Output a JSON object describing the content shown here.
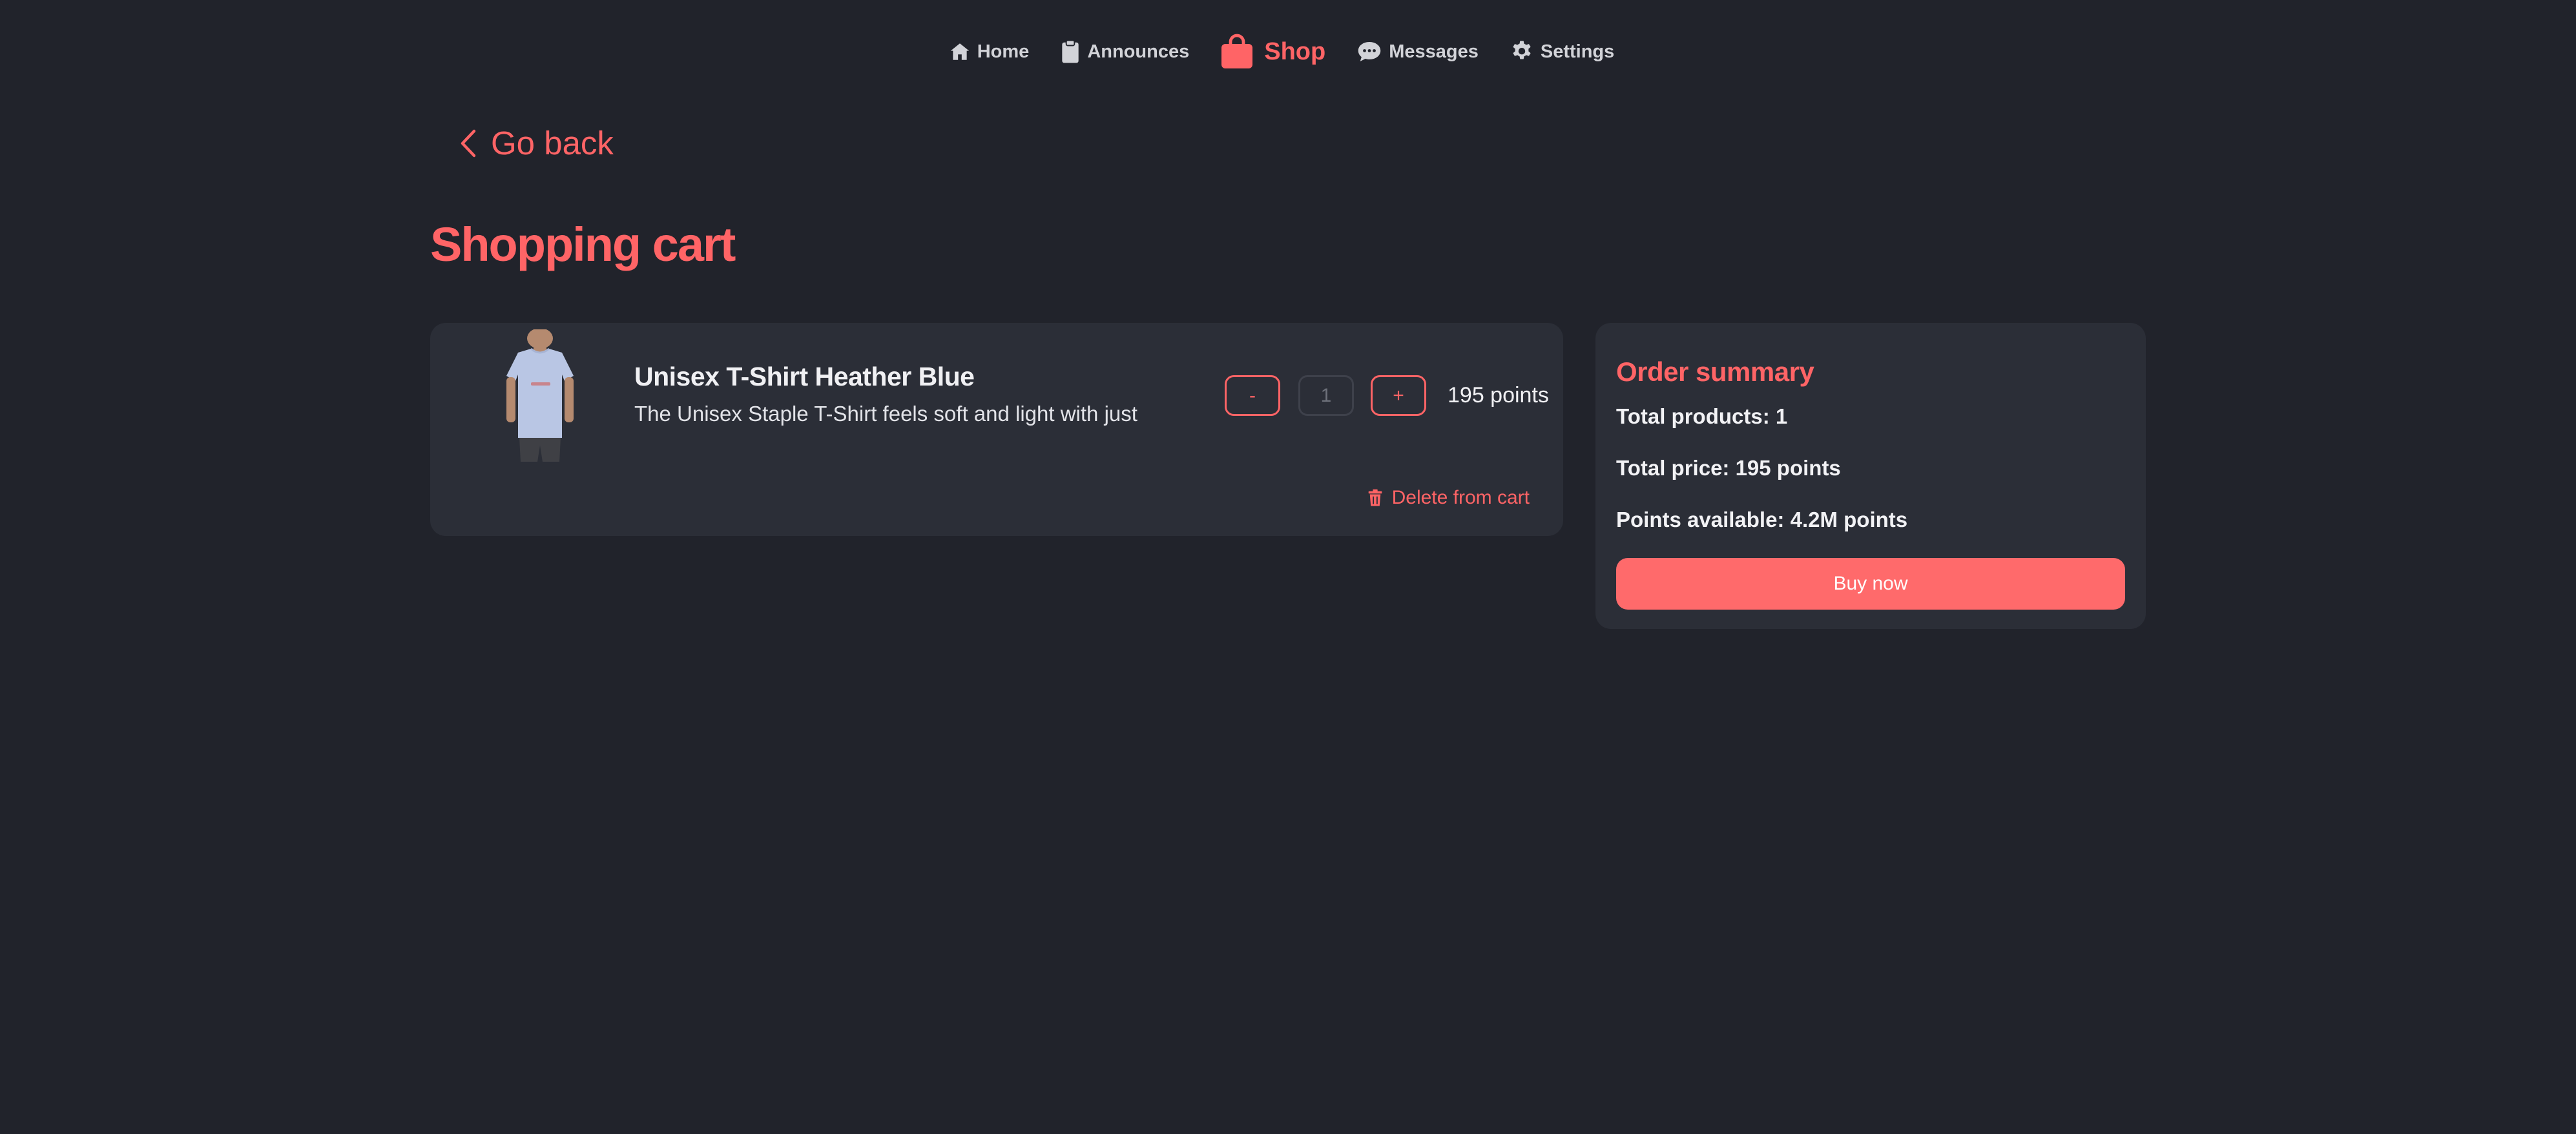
{
  "nav": {
    "items": [
      {
        "label": "Home",
        "icon": "home-icon"
      },
      {
        "label": "Announces",
        "icon": "clipboard-icon"
      },
      {
        "label": "Shop",
        "icon": "shopping-bag-icon",
        "active": true
      },
      {
        "label": "Messages",
        "icon": "chat-bubble-icon"
      },
      {
        "label": "Settings",
        "icon": "gear-icon"
      }
    ]
  },
  "go_back": {
    "label": "Go back",
    "icon": "chevron-left-icon"
  },
  "page_title": "Shopping cart",
  "cart": {
    "items": [
      {
        "name": "Unisex T-Shirt Heather Blue",
        "description": "The Unisex Staple T-Shirt feels soft and light with just",
        "quantity": "1",
        "decrement_label": "-",
        "increment_label": "+",
        "price": "195 points",
        "delete_label": "Delete from cart",
        "delete_icon": "trash-icon",
        "image": "t-shirt-product-photo"
      }
    ]
  },
  "summary": {
    "title": "Order summary",
    "total_products": "Total products: 1",
    "total_price": "Total price: 195 points",
    "points_available": "Points available: 4.2M points",
    "buy_label": "Buy now"
  },
  "colors": {
    "background": "#21232b",
    "card": "#2b2e37",
    "accent": "#ff6466",
    "text": "#f0f0f3",
    "nav_text": "#d2d3d8"
  }
}
